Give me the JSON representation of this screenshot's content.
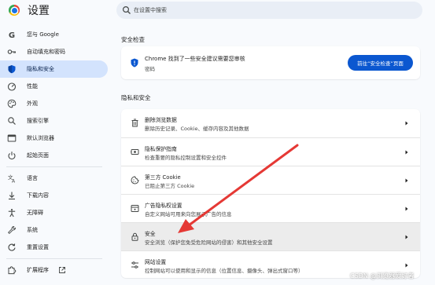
{
  "header": {
    "title": "设置"
  },
  "search": {
    "placeholder": "在设置中搜索"
  },
  "sidebar": {
    "items": [
      {
        "label": "您与 Google",
        "icon": "google-g-icon"
      },
      {
        "label": "自动填充和密码",
        "icon": "key-icon"
      },
      {
        "label": "隐私和安全",
        "icon": "shield-icon",
        "active": true
      },
      {
        "label": "性能",
        "icon": "speedometer-icon"
      },
      {
        "label": "外观",
        "icon": "palette-icon"
      },
      {
        "label": "搜索引擎",
        "icon": "search-icon"
      },
      {
        "label": "默认浏览器",
        "icon": "browser-window-icon"
      },
      {
        "label": "起始页面",
        "icon": "power-icon"
      },
      {
        "label": "语言",
        "icon": "translate-icon"
      },
      {
        "label": "下载内容",
        "icon": "download-icon"
      },
      {
        "label": "无障碍",
        "icon": "accessibility-icon"
      },
      {
        "label": "系统",
        "icon": "wrench-icon"
      },
      {
        "label": "重置设置",
        "icon": "reset-icon"
      },
      {
        "label": "扩展程序",
        "icon": "puzzle-icon"
      }
    ]
  },
  "safety_check": {
    "section_title": "安全检查",
    "title": "Chrome 找到了一些安全建议需要您审核",
    "subtitle": "密码",
    "button": "前往“安全检查”页面"
  },
  "privacy": {
    "section_title": "隐私和安全",
    "rows": [
      {
        "title": "删除浏览数据",
        "subtitle": "删除历史记录、Cookie、缓存内容及其他数据",
        "icon": "trash-icon"
      },
      {
        "title": "隐私保护指南",
        "subtitle": "检查重要的隐私控制设置和安全控件",
        "icon": "privacy-guide-icon"
      },
      {
        "title": "第三方 Cookie",
        "subtitle": "已阻止第三方 Cookie",
        "icon": "cookie-icon"
      },
      {
        "title": "广告隐私权设置",
        "subtitle": "自定义网站可用来向您展示广告的信息",
        "icon": "ad-privacy-icon"
      },
      {
        "title": "安全",
        "subtitle": "安全浏览（保护您免受危险网站的侵害）和其他安全设置",
        "icon": "lock-icon",
        "highlighted": true
      },
      {
        "title": "网站设置",
        "subtitle": "控制网站可以使用和显示的信息（位置信息、摄像头、弹出式窗口等）",
        "icon": "site-settings-icon"
      }
    ]
  },
  "annotation": {
    "arrow_color": "#e53935"
  },
  "watermark": "CSDN @浏览器爱好者",
  "colors": {
    "accent": "#0b57d0",
    "active_nav": "#d3e3fd",
    "background": "#f8fafd"
  }
}
